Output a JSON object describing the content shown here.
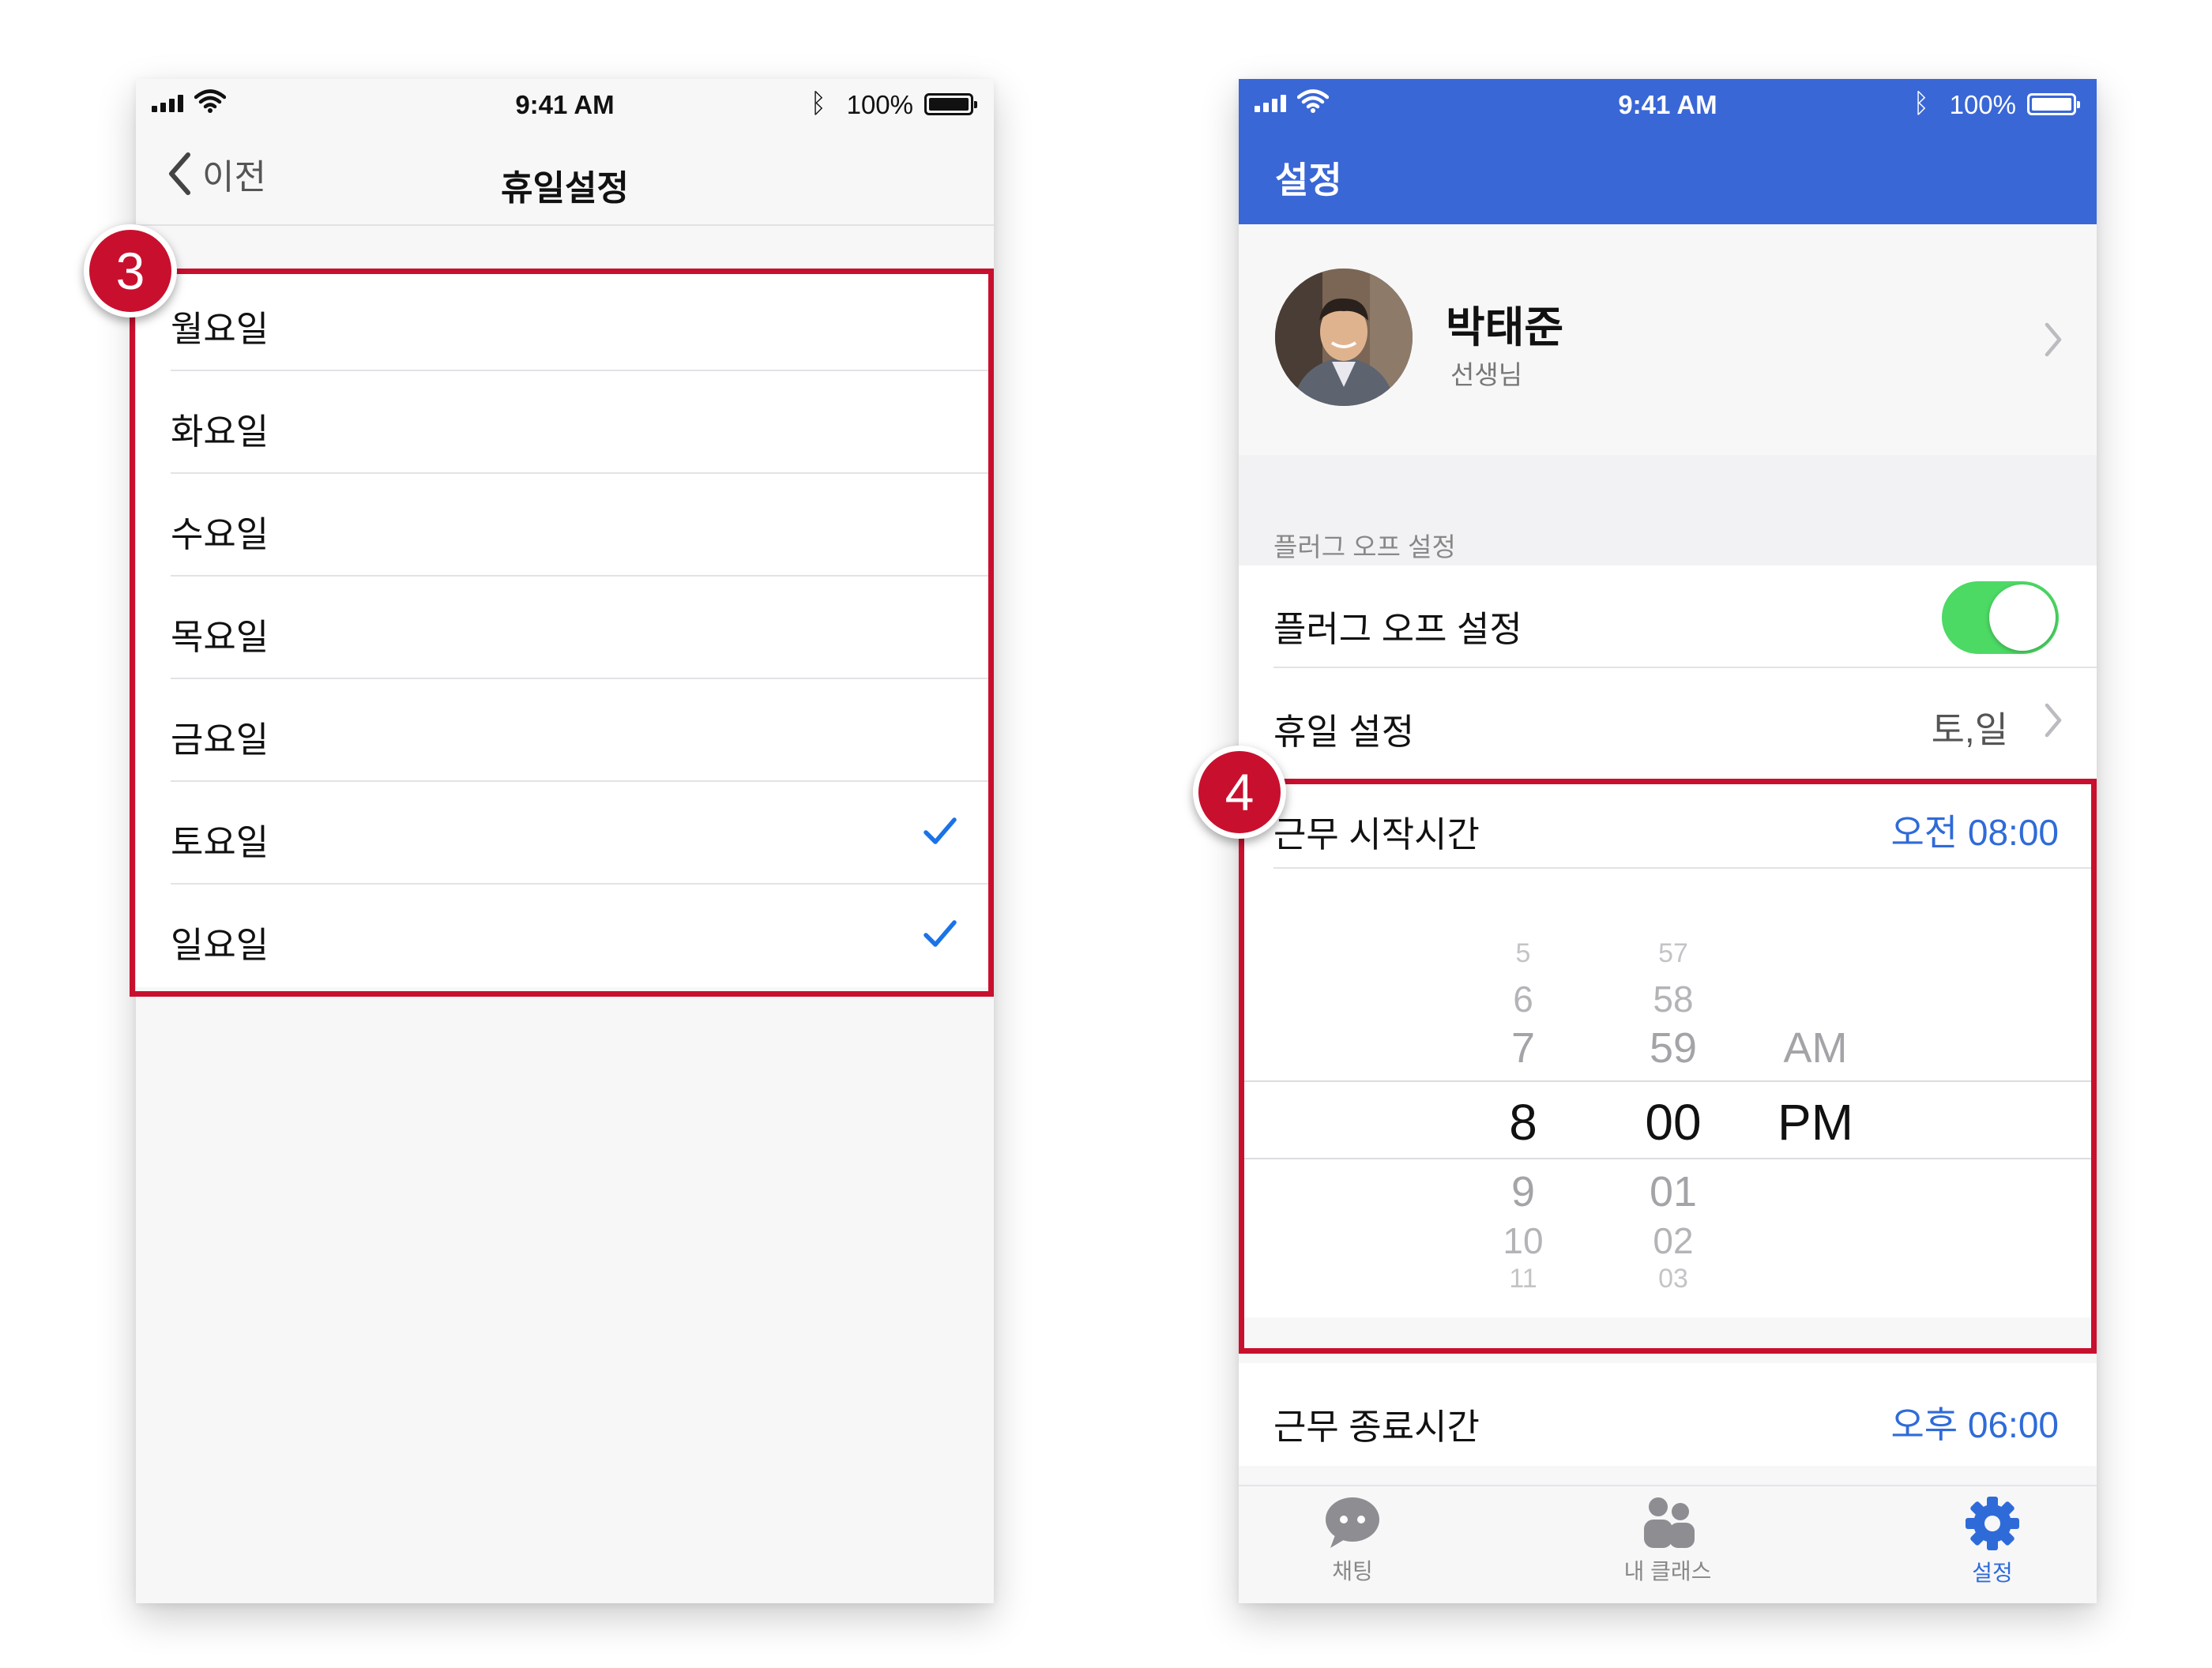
{
  "status_bar": {
    "time": "9:41 AM",
    "battery": "100%"
  },
  "left_screen": {
    "back_label": "이전",
    "title": "휴일설정",
    "days": [
      {
        "label": "월요일",
        "checked": false
      },
      {
        "label": "화요일",
        "checked": false
      },
      {
        "label": "수요일",
        "checked": false
      },
      {
        "label": "목요일",
        "checked": false
      },
      {
        "label": "금요일",
        "checked": false
      },
      {
        "label": "토요일",
        "checked": true
      },
      {
        "label": "일요일",
        "checked": true
      }
    ],
    "check_color": "#1a73e8"
  },
  "right_screen": {
    "header_title": "설정",
    "header_color": "#3a67d6",
    "profile": {
      "name": "박태준",
      "role": "선생님"
    },
    "section_title": "플러그 오프 설정",
    "plug_off": {
      "label": "플러그 오프 설정",
      "enabled": true
    },
    "holiday": {
      "label": "휴일 설정",
      "value": "토,일"
    },
    "work_start": {
      "label": "근무 시작시간",
      "value": "오전 08:00"
    },
    "picker": {
      "hours": [
        "5",
        "6",
        "7",
        "8",
        "9",
        "10",
        "11"
      ],
      "minutes": [
        "57",
        "58",
        "59",
        "00",
        "01",
        "02",
        "03"
      ],
      "ampm_above": "AM",
      "ampm_selected": "PM"
    },
    "work_end": {
      "label": "근무 종료시간",
      "value": "오후 06:00"
    },
    "tabs": [
      {
        "label": "채팅",
        "icon": "chat-bubble-icon",
        "active": false
      },
      {
        "label": "내 클래스",
        "icon": "people-icon",
        "active": false
      },
      {
        "label": "설정",
        "icon": "gear-icon",
        "active": true
      }
    ],
    "link_color": "#2f6bd8",
    "toggle_color": "#4cd964"
  },
  "annotations": {
    "step_left": "3",
    "step_right": "4",
    "highlight_color": "#c8102e"
  }
}
